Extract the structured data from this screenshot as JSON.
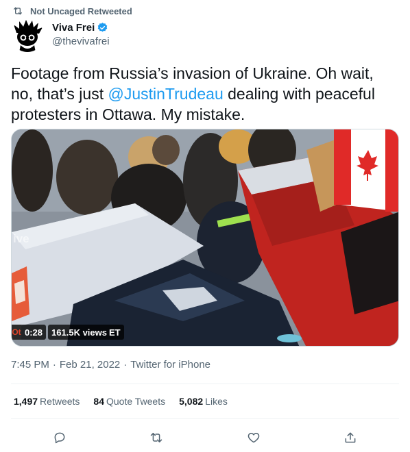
{
  "social_context": {
    "label": "Not Uncaged Retweeted",
    "icon": "retweet-icon"
  },
  "author": {
    "display_name": "Viva Frei",
    "handle": "@thevivafrei",
    "verified_color": "#1d9bf0"
  },
  "tweet": {
    "text_before": "Footage from Russia’s invasion of Ukraine. Oh wait, no, that’s just ",
    "mention": "@JustinTrudeau",
    "text_after": " dealing with peaceful protesters in Ottawa. My mistake."
  },
  "media": {
    "watermark": "ive",
    "cut_tag": "Ot",
    "duration": "0:28",
    "views": "161.5K views",
    "views_suffix": "ET"
  },
  "meta": {
    "time": "7:45 PM",
    "date": "Feb 21, 2022",
    "source": "Twitter for iPhone"
  },
  "stats": {
    "retweets_count": "1,497",
    "retweets_label": "Retweets",
    "quotes_count": "84",
    "quotes_label": "Quote Tweets",
    "likes_count": "5,082",
    "likes_label": "Likes"
  },
  "actions": [
    "reply-icon",
    "retweet-icon",
    "like-icon",
    "share-icon"
  ],
  "colors": {
    "accent": "#1d9bf0",
    "secondary_text": "#536471",
    "primary_text": "#0f1419"
  }
}
